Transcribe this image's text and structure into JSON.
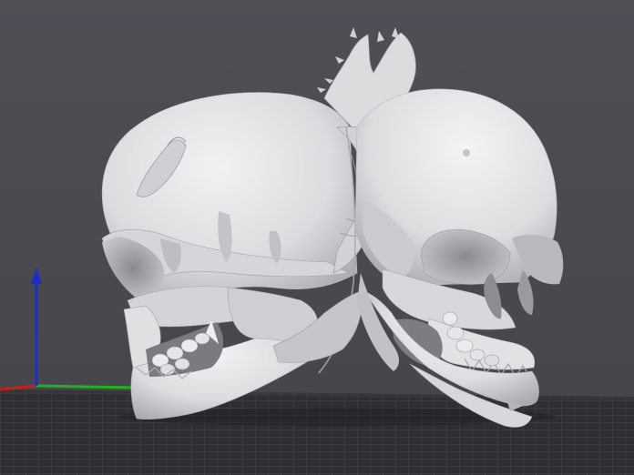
{
  "viewport": {
    "background_top": "#4d4d54",
    "background_bottom": "#45454b",
    "floor_color": "#2e2e31",
    "floor_grid_color": "#505056",
    "model_color": "#e4e4e6",
    "model_shadow": "#9a9aa0"
  },
  "axes": {
    "x_color": "#c81e1e",
    "y_color": "#1eb41e",
    "z_color": "#1e2ec8"
  },
  "model": {
    "name_icon": "twin-skull-model"
  }
}
